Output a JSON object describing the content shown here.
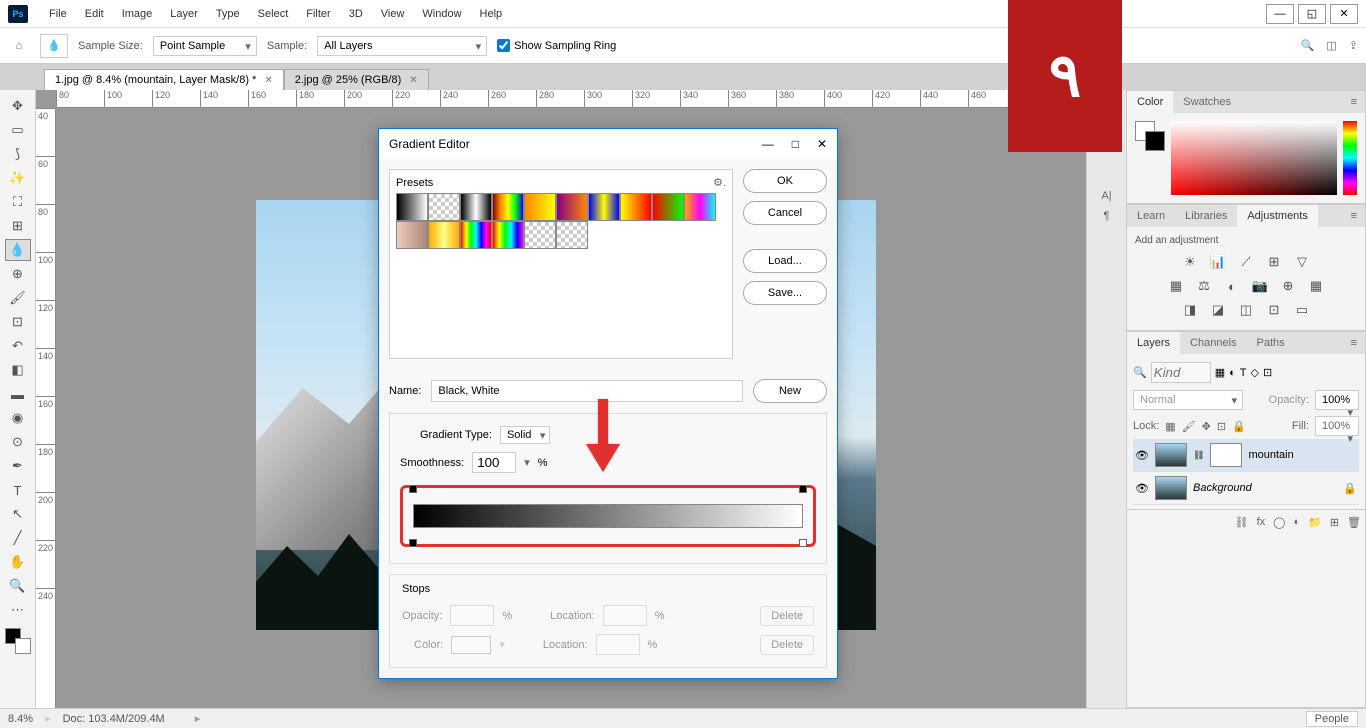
{
  "badge": "٩",
  "menu": [
    "File",
    "Edit",
    "Image",
    "Layer",
    "Type",
    "Select",
    "Filter",
    "3D",
    "View",
    "Window",
    "Help"
  ],
  "options": {
    "sample_size_label": "Sample Size:",
    "sample_size_value": "Point Sample",
    "sample_label": "Sample:",
    "sample_value": "All Layers",
    "sampling_ring": "Show Sampling Ring"
  },
  "tabs": [
    {
      "label": "1.jpg @ 8.4% (mountain, Layer Mask/8) *",
      "active": true
    },
    {
      "label": "2.jpg @ 25% (RGB/8)",
      "active": false
    }
  ],
  "ruler_h": [
    "80",
    "100",
    "120",
    "140",
    "160",
    "180",
    "200",
    "220",
    "240",
    "260",
    "280",
    "300",
    "320",
    "340",
    "360",
    "380",
    "400",
    "420",
    "440",
    "460"
  ],
  "ruler_v": [
    "40",
    "60",
    "80",
    "100",
    "120",
    "140",
    "160",
    "180",
    "200",
    "220",
    "240"
  ],
  "panels": {
    "color_tab": "Color",
    "swatches_tab": "Swatches",
    "learn_tab": "Learn",
    "libraries_tab": "Libraries",
    "adjustments_tab": "Adjustments",
    "add_adj": "Add an adjustment",
    "layers_tab": "Layers",
    "channels_tab": "Channels",
    "paths_tab": "Paths",
    "kind_placeholder": "Kind",
    "blend_mode": "Normal",
    "opacity_label": "Opacity:",
    "opacity_val": "100%",
    "lock_label": "Lock:",
    "fill_label": "Fill:",
    "fill_val": "100%",
    "layer1": "mountain",
    "layer2": "Background"
  },
  "dialog": {
    "title": "Gradient Editor",
    "presets": "Presets",
    "ok": "OK",
    "cancel": "Cancel",
    "load": "Load...",
    "save": "Save...",
    "new": "New",
    "name_label": "Name:",
    "name_value": "Black, White",
    "gtype_label": "Gradient Type:",
    "gtype_value": "Solid",
    "smooth_label": "Smoothness:",
    "smooth_value": "100",
    "percent": "%",
    "stops": "Stops",
    "opacity_label": "Opacity:",
    "location_label": "Location:",
    "color_label": "Color:",
    "delete": "Delete"
  },
  "status": {
    "zoom": "8.4%",
    "doc": "Doc: 103.4M/209.4M",
    "people": "People"
  }
}
